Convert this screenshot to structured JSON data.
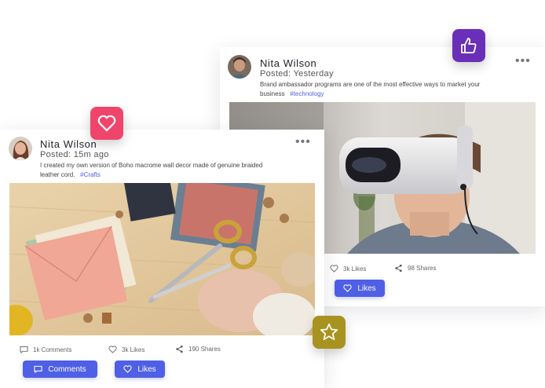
{
  "back_post": {
    "author": "Nita Wilson",
    "posted": "Posted: Yesterday",
    "text": "Brand ambassador programs are one of the most effective ways to market your business",
    "tag": "#technology",
    "likes": "3k Likes",
    "shares": "98 Shares",
    "like_button": "Likes"
  },
  "front_post": {
    "author": "Nita Wilson",
    "posted": "Posted: 15m ago",
    "text": "I created my own version of Boho macrome wall decor made of genuine braided leather cord.",
    "tag": "#Crafts",
    "comments": "1k Comments",
    "likes": "3k Likes",
    "shares": "190 Shares",
    "comment_button": "Comments",
    "like_button": "Likes"
  },
  "colors": {
    "accent": "#4f5fe6",
    "heart_badge": "#f0456b",
    "thumbs_badge": "#6a2fb8",
    "star_badge": "#a89220"
  },
  "icons": {
    "heart_badge": "heart-icon",
    "thumbs_badge": "thumbs-up-icon",
    "star_badge": "star-icon",
    "more": "more-dots-icon",
    "comment": "comment-icon",
    "like": "heart-outline-icon",
    "share": "share-icon"
  }
}
